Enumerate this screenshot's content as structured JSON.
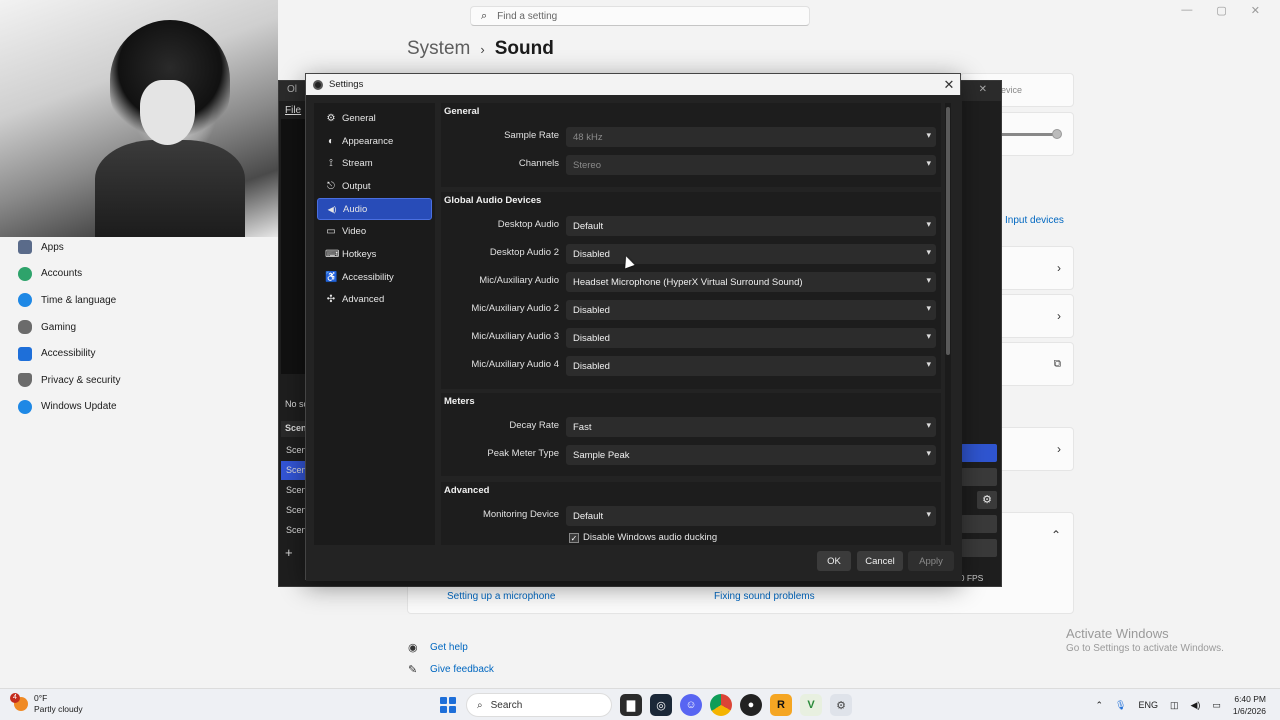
{
  "win_settings": {
    "search_placeholder": "Find a setting",
    "breadcrumb_parent": "System",
    "breadcrumb_current": "Sound",
    "nav_items": [
      {
        "label": "Apps",
        "color": "#5a6b8a"
      },
      {
        "label": "Accounts",
        "color": "#2ea36b"
      },
      {
        "label": "Time & language",
        "color": "#1e88e5"
      },
      {
        "label": "Gaming",
        "color": "#6b6b6b"
      },
      {
        "label": "Accessibility",
        "color": "#1e6fd9"
      },
      {
        "label": "Privacy & security",
        "color": "#6b6b6b"
      },
      {
        "label": "Windows Update",
        "color": "#1e88e5"
      }
    ],
    "device_label": "evice",
    "input_devices": "Input devices",
    "link_microphone": "Setting up a microphone",
    "link_fixing": "Fixing sound problems",
    "get_help": "Get help",
    "give_feedback": "Give feedback",
    "activate_title": "Activate Windows",
    "activate_sub": "Go to Settings to activate Windows."
  },
  "obs_main": {
    "title": "Ol",
    "menu_file": "File",
    "no_source": "No sc",
    "scenes_header": "Scene",
    "scenes": [
      "Scene",
      "Scene",
      "Scene",
      "Scene",
      "Scene"
    ],
    "fps": "40 FPS"
  },
  "dialog": {
    "title": "Settings",
    "sidebar": [
      {
        "label": "General",
        "icon": "gear-icon",
        "glyph": "⚙"
      },
      {
        "label": "Appearance",
        "icon": "palette-icon",
        "glyph": "◐"
      },
      {
        "label": "Stream",
        "icon": "stream-icon",
        "glyph": "⟟"
      },
      {
        "label": "Output",
        "icon": "output-icon",
        "glyph": "⎋"
      },
      {
        "label": "Audio",
        "icon": "speaker-icon",
        "glyph": "◀)"
      },
      {
        "label": "Video",
        "icon": "monitor-icon",
        "glyph": "▭"
      },
      {
        "label": "Hotkeys",
        "icon": "keyboard-icon",
        "glyph": "⌨"
      },
      {
        "label": "Accessibility",
        "icon": "accessibility-icon",
        "glyph": "♿"
      },
      {
        "label": "Advanced",
        "icon": "wrench-icon",
        "glyph": "✣"
      }
    ],
    "active_item": "Audio",
    "general": {
      "title": "General",
      "sample_rate_label": "Sample Rate",
      "sample_rate_value": "48 kHz",
      "channels_label": "Channels",
      "channels_value": "Stereo"
    },
    "global_audio": {
      "title": "Global Audio Devices",
      "rows": [
        {
          "label": "Desktop Audio",
          "value": "Default"
        },
        {
          "label": "Desktop Audio 2",
          "value": "Disabled"
        },
        {
          "label": "Mic/Auxiliary Audio",
          "value": "Headset Microphone (HyperX Virtual Surround Sound)"
        },
        {
          "label": "Mic/Auxiliary Audio 2",
          "value": "Disabled"
        },
        {
          "label": "Mic/Auxiliary Audio 3",
          "value": "Disabled"
        },
        {
          "label": "Mic/Auxiliary Audio 4",
          "value": "Disabled"
        }
      ]
    },
    "meters": {
      "title": "Meters",
      "decay_label": "Decay Rate",
      "decay_value": "Fast",
      "peak_label": "Peak Meter Type",
      "peak_value": "Sample Peak"
    },
    "advanced": {
      "title": "Advanced",
      "monitoring_label": "Monitoring Device",
      "monitoring_value": "Default",
      "ducking_label": "Disable Windows audio ducking",
      "ducking_checked": true
    },
    "buttons": {
      "ok": "OK",
      "cancel": "Cancel",
      "apply": "Apply"
    }
  },
  "taskbar": {
    "weather_temp": "0°F",
    "weather_desc": "Partly cloudy",
    "weather_badge": "4",
    "search_label": "Search",
    "language": "ENG",
    "time": "6:40 PM",
    "date": "1/6/2026"
  }
}
